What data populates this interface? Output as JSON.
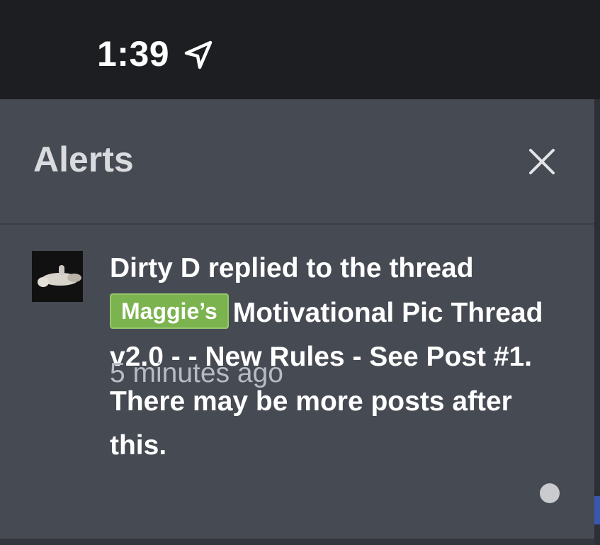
{
  "status_bar": {
    "time": "1:39",
    "location_icon": "location-arrow-icon"
  },
  "alerts": {
    "title": "Alerts",
    "close_icon": "close-icon",
    "items": [
      {
        "username": "Dirty D",
        "action_text": " replied to the thread ",
        "prefix": "Maggie’s",
        "thread_title": "Motivational Pic Thread v2.0 - - New Rules - See Post #1",
        "suffix_text": ". There may be more posts after this.",
        "time_ago": "5 minutes ago",
        "unread": true
      }
    ]
  },
  "colors": {
    "panel_bg": "#464a53",
    "status_bg": "#1c1e22",
    "prefix_green": "#7bb34f",
    "unread_dot": "#c9cbce"
  }
}
